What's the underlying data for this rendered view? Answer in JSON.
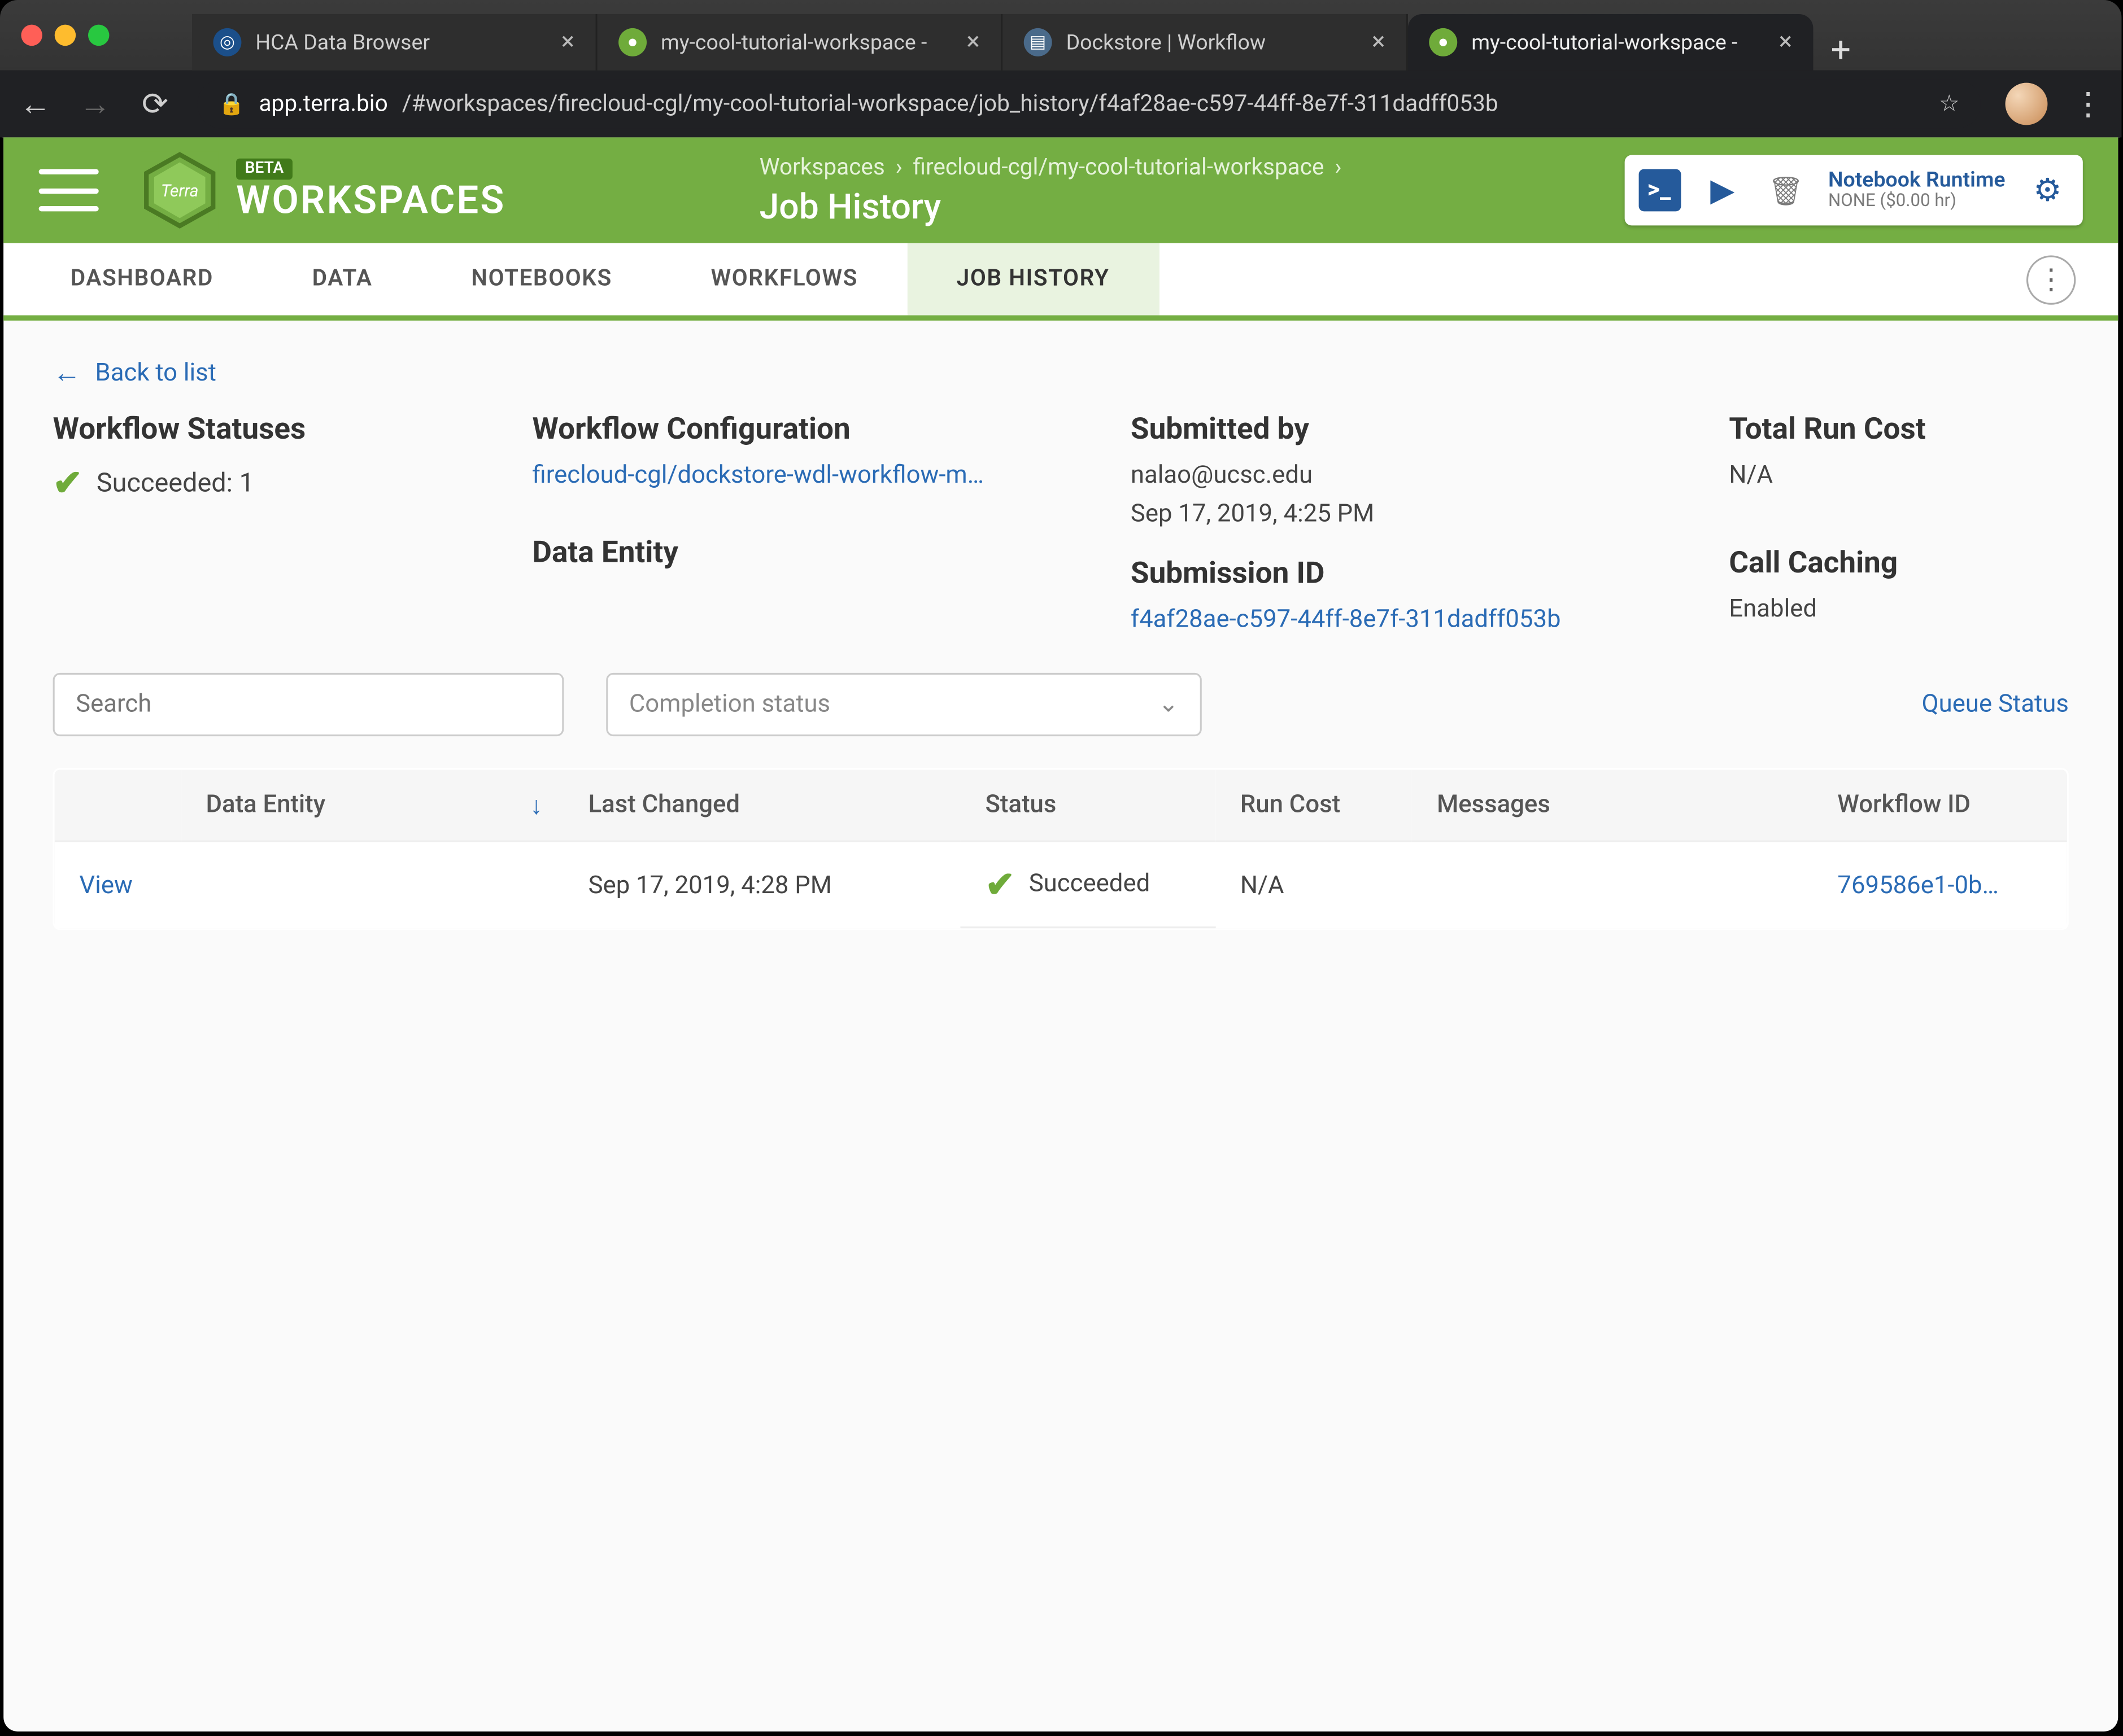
{
  "browser": {
    "tabs": [
      {
        "title": "HCA Data Browser",
        "favicon_bg": "#1b4f8a",
        "active": false
      },
      {
        "title": "my-cool-tutorial-workspace - ",
        "favicon_bg": "#6fab3a",
        "active": false
      },
      {
        "title": "Dockstore | Workflow",
        "favicon_bg": "#4a6a8a",
        "active": false
      },
      {
        "title": "my-cool-tutorial-workspace - ",
        "favicon_bg": "#6fab3a",
        "active": true
      }
    ],
    "url_host": "app.terra.bio",
    "url_path": "/#workspaces/firecloud-cgl/my-cool-tutorial-workspace/job_history/f4af28ae-c597-44ff-8e7f-311dadff053b"
  },
  "header": {
    "beta_badge": "BETA",
    "brand": "WORKSPACES",
    "breadcrumb1": "Workspaces",
    "breadcrumb2": "firecloud-cgl/my-cool-tutorial-workspace",
    "page_title": "Job History",
    "runtime_title": "Notebook Runtime",
    "runtime_sub_label": "NONE",
    "runtime_sub_price": "($0.00 hr)"
  },
  "tabs": {
    "items": [
      "DASHBOARD",
      "DATA",
      "NOTEBOOKS",
      "WORKFLOWS",
      "JOB HISTORY"
    ],
    "active_index": 4
  },
  "summary": {
    "back_link": "Back to list",
    "statuses_title": "Workflow Statuses",
    "status_text": "Succeeded: 1",
    "config_title": "Workflow Configuration",
    "config_link": "firecloud-cgl/dockstore-wdl-workflow-m…",
    "entity_title": "Data Entity",
    "submitted_title": "Submitted by",
    "submitted_by": "nalao@ucsc.edu",
    "submitted_at": "Sep 17, 2019, 4:25 PM",
    "subid_title": "Submission ID",
    "subid": "f4af28ae-c597-44ff-8e7f-311dadff053b",
    "cost_title": "Total Run Cost",
    "cost_value": "N/A",
    "caching_title": "Call Caching",
    "caching_value": "Enabled"
  },
  "filters": {
    "search_placeholder": "Search",
    "completion_placeholder": "Completion status",
    "queue_status": "Queue Status"
  },
  "table": {
    "headers": {
      "view": "",
      "data_entity": "Data Entity",
      "last_changed": "Last Changed",
      "status": "Status",
      "run_cost": "Run Cost",
      "messages": "Messages",
      "workflow_id": "Workflow ID"
    },
    "rows": [
      {
        "view": "View",
        "data_entity": "",
        "last_changed": "Sep 17, 2019, 4:28 PM",
        "status": "Succeeded",
        "run_cost": "N/A",
        "messages": "",
        "workflow_id": "769586e1-0b…"
      }
    ]
  }
}
